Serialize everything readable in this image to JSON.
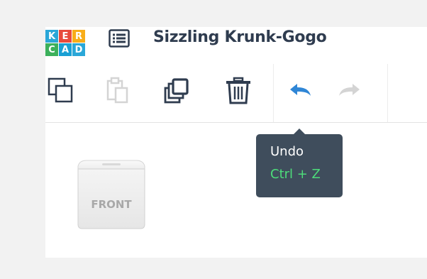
{
  "app": {
    "logo_letters": [
      "K",
      "E",
      "R",
      "C",
      "A",
      "D"
    ],
    "project_title": "Sizzling Krunk-Gogo"
  },
  "toolbar": {
    "buttons": [
      {
        "name": "copy",
        "icon": "copy-icon",
        "enabled": true
      },
      {
        "name": "paste",
        "icon": "paste-icon",
        "enabled": false
      },
      {
        "name": "duplicate",
        "icon": "duplicate-icon",
        "enabled": true
      },
      {
        "name": "delete",
        "icon": "trash-icon",
        "enabled": true
      },
      {
        "name": "undo",
        "icon": "undo-icon",
        "enabled": true
      },
      {
        "name": "redo",
        "icon": "redo-icon",
        "enabled": false
      }
    ]
  },
  "tooltip": {
    "label": "Undo",
    "shortcut": "Ctrl + Z"
  },
  "viewcube": {
    "face_label": "FRONT"
  },
  "colors": {
    "title": "#2f3c4f",
    "icon": "#2f3c4f",
    "icon_disabled": "#d4d4d4",
    "accent_blue": "#2f86d6",
    "tooltip_bg": "#3f4d5c",
    "shortcut_green": "#4ddc7a"
  }
}
